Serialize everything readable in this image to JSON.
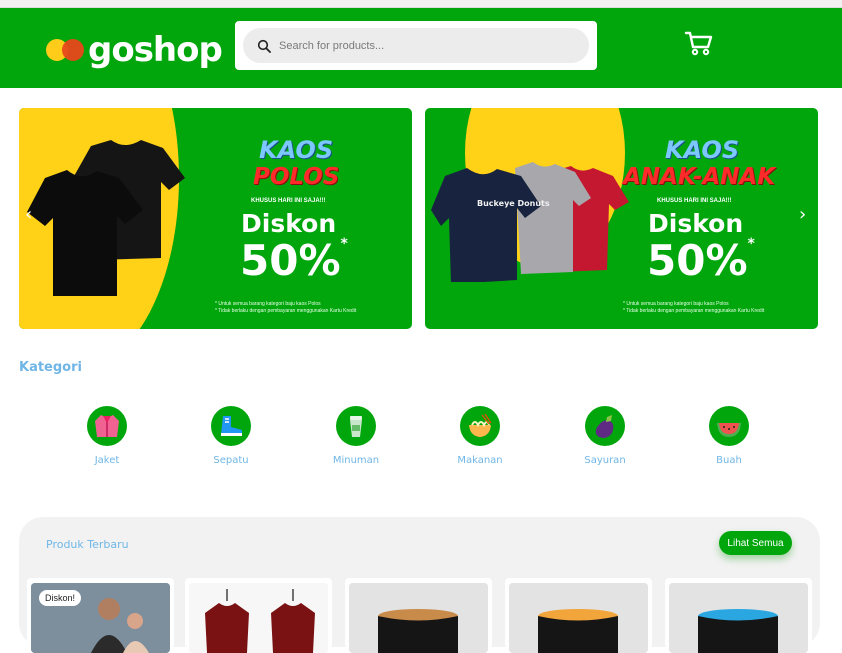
{
  "header": {
    "logo_text": "goshop",
    "search_placeholder": "Search for products...",
    "brand_color": "#00a60c"
  },
  "banners": [
    {
      "title_line1": "KAOS",
      "title_line2": "POLOS",
      "subtitle": "KHUSUS HARI INI SAJA!!!",
      "discount_label": "Diskon",
      "discount_value": "50%",
      "discount_mark": "*",
      "note_line1": "* Untuk semua barang kategori baju kaos Polos",
      "note_line2": "* Tidak berlaku dengan pembayaran menggunakan Kartu Kredit"
    },
    {
      "title_line1": "KAOS",
      "title_line2": "ANAK-ANAK",
      "subtitle": "KHUSUS HARI INI SAJA!!!",
      "discount_label": "Diskon",
      "discount_value": "50%",
      "discount_mark": "*",
      "note_line1": "* Untuk semua barang kategori baju kaos Polos",
      "note_line2": "* Tidak berlaku dengan pembayaran menggunakan Kartu Kredit",
      "shirt_text": "Buckeye Donuts"
    }
  ],
  "carousel": {
    "prev_icon": "‹",
    "next_icon": "›"
  },
  "categories": {
    "title": "Kategori",
    "items": [
      {
        "label": "Jaket",
        "icon": "jacket-icon"
      },
      {
        "label": "Sepatu",
        "icon": "shoe-icon"
      },
      {
        "label": "Minuman",
        "icon": "drink-icon"
      },
      {
        "label": "Makanan",
        "icon": "noodle-icon"
      },
      {
        "label": "Sayuran",
        "icon": "eggplant-icon"
      },
      {
        "label": "Buah",
        "icon": "watermelon-icon"
      }
    ]
  },
  "products": {
    "title": "Produk Terbaru",
    "see_all": "Lihat Semua",
    "badge": "Diskon!"
  }
}
